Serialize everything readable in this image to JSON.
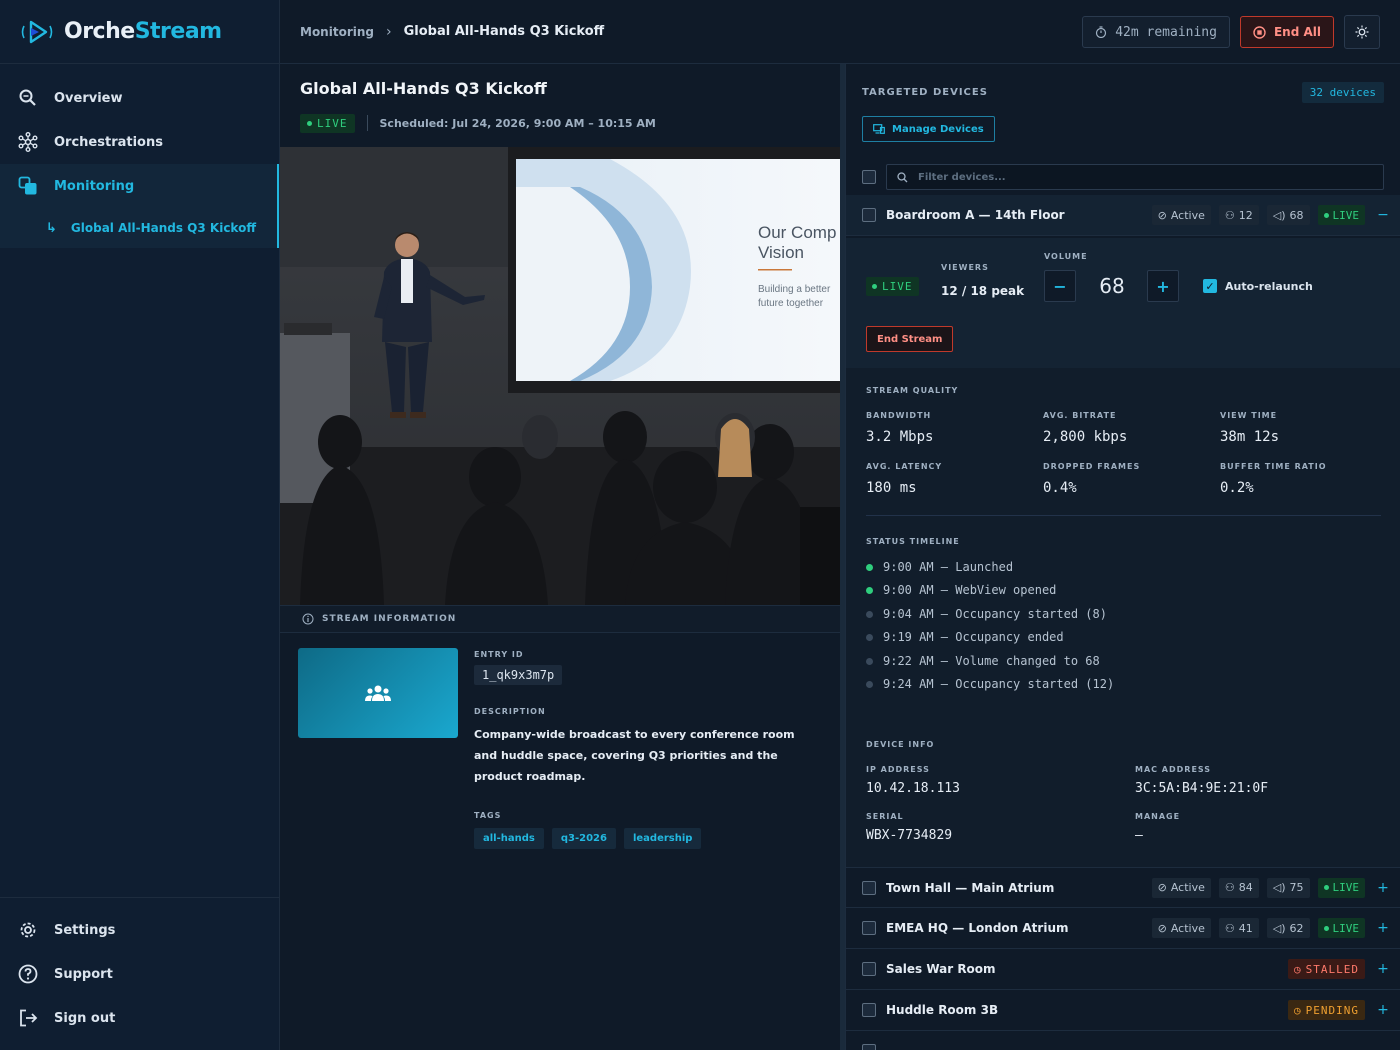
{
  "brand": {
    "name_a": "Orche",
    "name_b": "Stream"
  },
  "nav": {
    "items": [
      {
        "label": "Overview",
        "icon": "search-icon"
      },
      {
        "label": "Orchestrations",
        "icon": "network-icon"
      },
      {
        "label": "Monitoring",
        "icon": "layers-icon"
      }
    ],
    "sub_item": "Global All-Hands Q3 Kickoff",
    "bottom": [
      {
        "label": "Settings",
        "icon": "gear-icon"
      },
      {
        "label": "Support",
        "icon": "help-icon"
      },
      {
        "label": "Sign out",
        "icon": "sign-out-icon"
      }
    ]
  },
  "topbar": {
    "breadcrumb_root": "Monitoring",
    "breadcrumb_current": "Global All-Hands Q3 Kickoff",
    "timer": "42m remaining",
    "end_all": "End All"
  },
  "stream": {
    "title": "Global All-Hands Q3 Kickoff",
    "status": "LIVE",
    "scheduled": "Scheduled: Jul 24, 2026, 9:00 AM – 10:15 AM",
    "slide_title_1": "Our Comp",
    "slide_title_2": "Vision",
    "slide_sub_1": "Building a better",
    "slide_sub_2": "future together",
    "info_header": "STREAM INFORMATION",
    "entry_label": "ENTRY ID",
    "entry_id": "1_qk9x3m7p",
    "desc_label": "DESCRIPTION",
    "description": "Company-wide broadcast to every conference room and huddle space, covering Q3 priorities and the product roadmap.",
    "tags_label": "TAGS",
    "tags": [
      "all-hands",
      "q3-2026",
      "leadership"
    ]
  },
  "devices": {
    "title": "TARGETED DEVICES",
    "count": "32 devices",
    "manage": "Manage Devices",
    "filter_placeholder": "Filter devices...",
    "list": [
      {
        "name": "Boardroom A — 14th Floor",
        "state": "Active",
        "viewers": "12",
        "volume": "68",
        "badge": "LIVE",
        "toggle": "−"
      },
      {
        "name": "Town Hall — Main Atrium",
        "state": "Active",
        "viewers": "84",
        "volume": "75",
        "badge": "LIVE",
        "toggle": "+"
      },
      {
        "name": "EMEA HQ — London Atrium",
        "state": "Active",
        "viewers": "41",
        "volume": "62",
        "badge": "LIVE",
        "toggle": "+"
      },
      {
        "name": "Sales War Room",
        "badge": "STALLED",
        "toggle": "+"
      },
      {
        "name": "Huddle Room 3B",
        "badge": "PENDING",
        "toggle": "+"
      }
    ],
    "expanded": {
      "live": "LIVE",
      "viewers_label": "VIEWERS",
      "viewers": "12 / 18 peak",
      "volume_label": "VOLUME",
      "volume": "68",
      "auto_relaunch": "Auto-relaunch",
      "end_stream": "End Stream",
      "quality_label": "STREAM QUALITY",
      "quality": [
        {
          "label": "BANDWIDTH",
          "value": "3.2 Mbps"
        },
        {
          "label": "AVG. BITRATE",
          "value": "2,800 kbps"
        },
        {
          "label": "VIEW TIME",
          "value": "38m 12s"
        },
        {
          "label": "AVG. LATENCY",
          "value": "180 ms"
        },
        {
          "label": "DROPPED FRAMES",
          "value": "0.4%"
        },
        {
          "label": "BUFFER TIME RATIO",
          "value": "0.2%"
        }
      ],
      "timeline_label": "STATUS TIMELINE",
      "timeline": [
        {
          "text": "9:00 AM — Launched",
          "active": true
        },
        {
          "text": "9:00 AM — WebView opened",
          "active": true
        },
        {
          "text": "9:04 AM — Occupancy started (8)",
          "active": false
        },
        {
          "text": "9:19 AM — Occupancy ended",
          "active": false
        },
        {
          "text": "9:22 AM — Volume changed to 68",
          "active": false
        },
        {
          "text": "9:24 AM — Occupancy started (12)",
          "active": false
        }
      ],
      "device_info_label": "DEVICE INFO",
      "ip_label": "IP ADDRESS",
      "ip": "10.42.18.113",
      "mac_label": "MAC ADDRESS",
      "mac": "3C:5A:B4:9E:21:0F",
      "serial_label": "SERIAL",
      "serial": "WBX-7734829",
      "manage_label": "MANAGE",
      "manage": "—"
    }
  },
  "colors": {
    "accent": "#22b8e0",
    "live": "#2fce7e",
    "danger": "#ff7a6b",
    "warning": "#f0a030",
    "bg": "#0f1a28"
  }
}
